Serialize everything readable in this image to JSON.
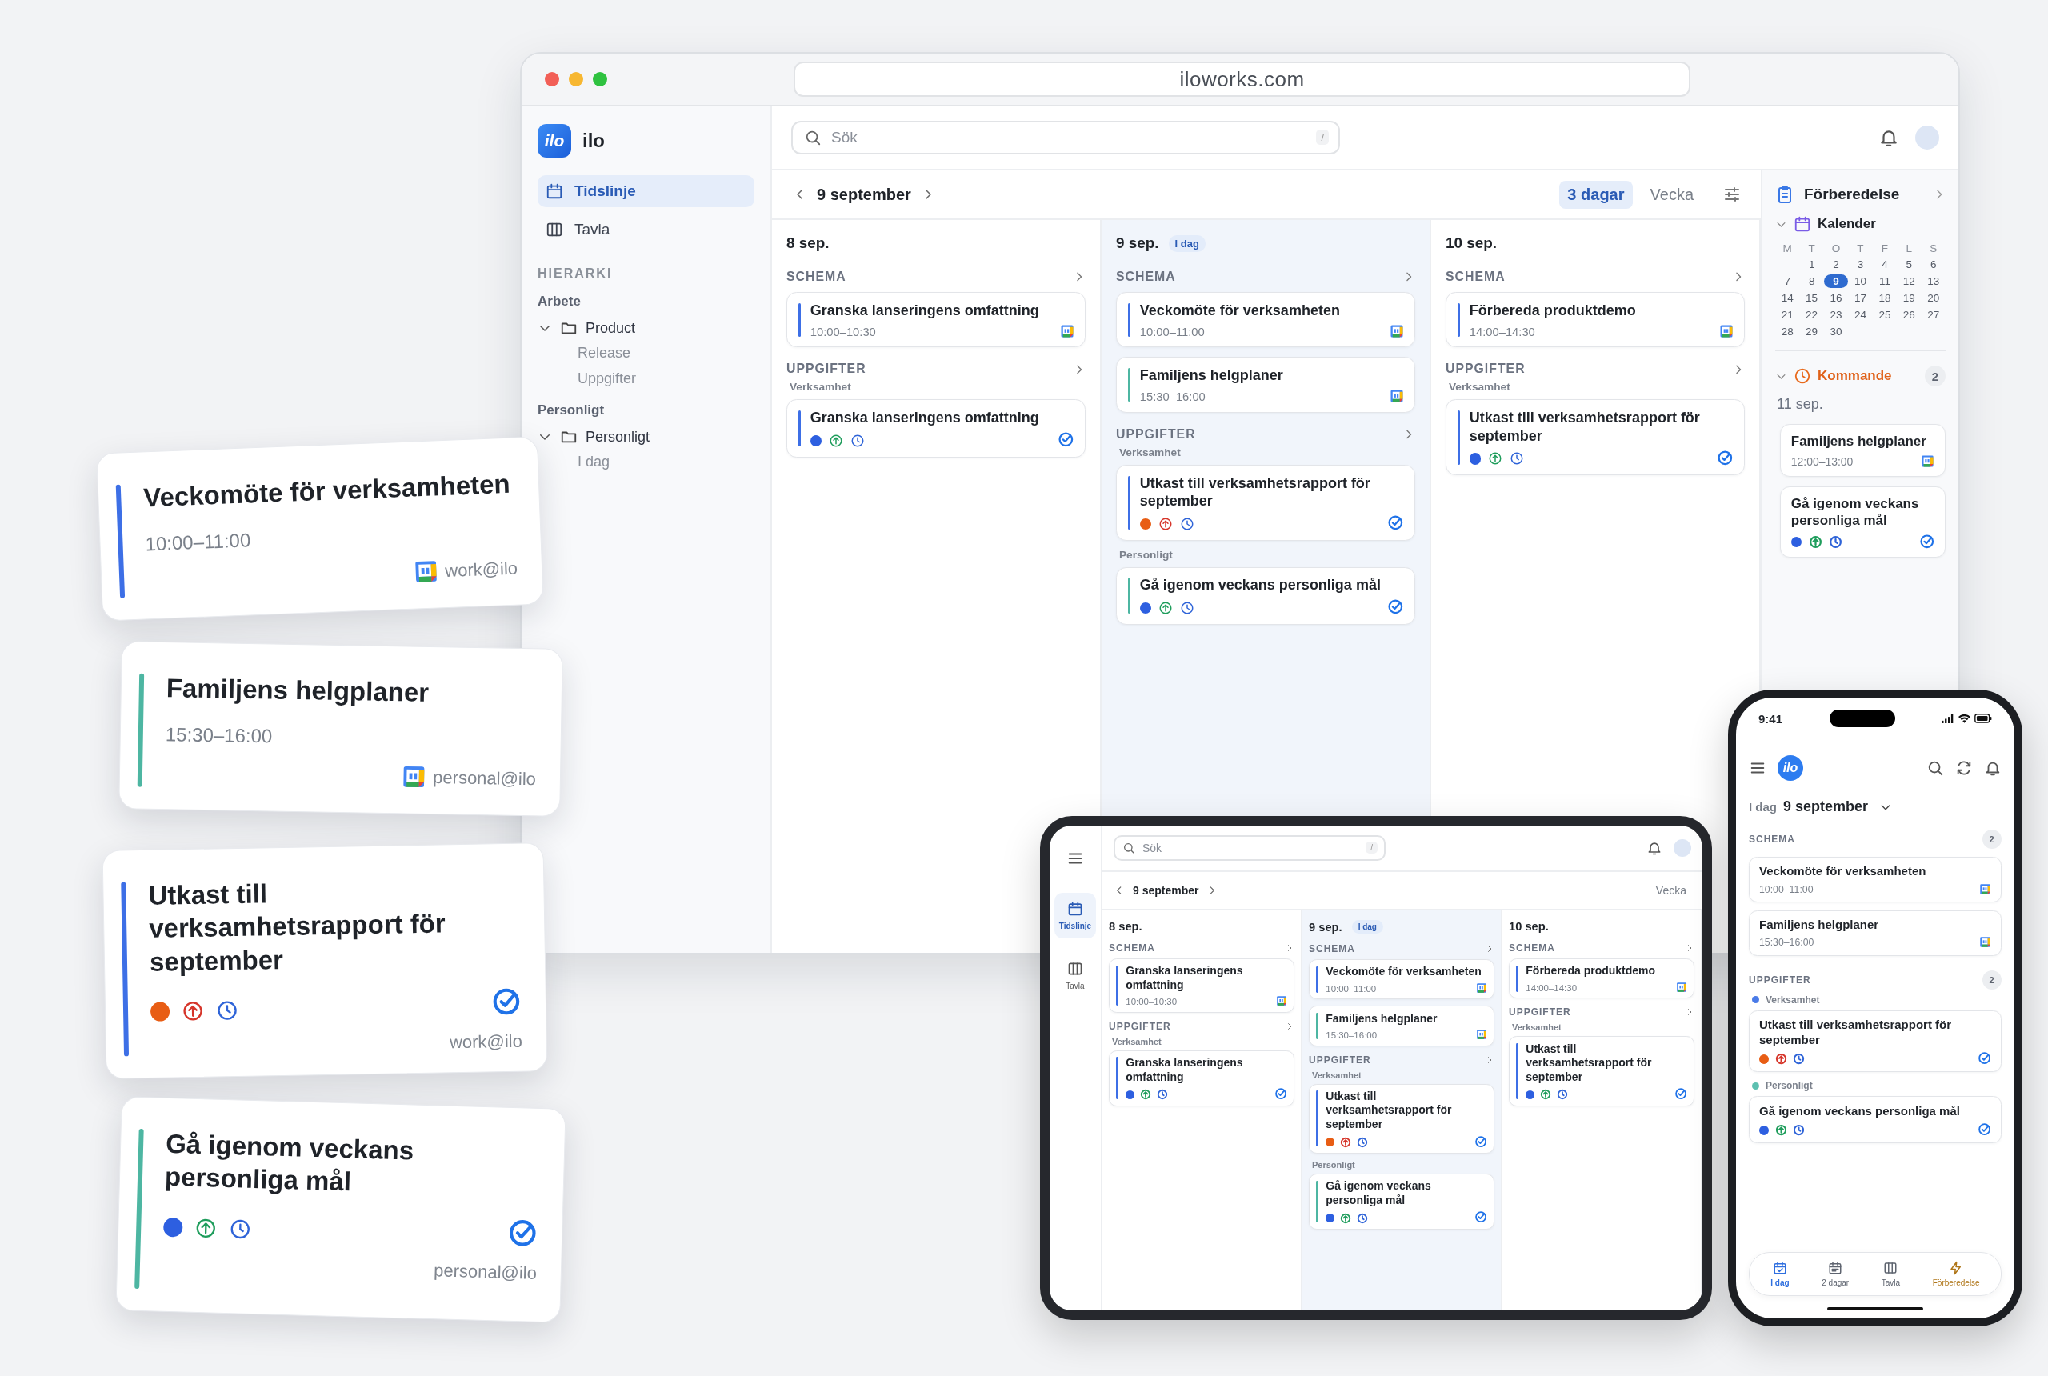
{
  "browser": {
    "url": "iloworks.com",
    "app": {
      "logo_mark": "ilo",
      "name": "ilo"
    },
    "nav": [
      {
        "label": "Tidslinje",
        "kind": "calendar",
        "selected": true
      },
      {
        "label": "Tavla",
        "kind": "board",
        "selected": false
      }
    ],
    "hierarchy_title": "HIERARKI",
    "groups": [
      {
        "label": "Arbete",
        "items": [
          {
            "label": "Product",
            "expanded": true,
            "children": [
              {
                "label": "Release"
              },
              {
                "label": "Uppgifter"
              }
            ]
          }
        ]
      },
      {
        "label": "Personligt",
        "items": [
          {
            "label": "Personligt",
            "expanded": true,
            "children": [
              {
                "label": "I dag"
              }
            ]
          }
        ]
      }
    ],
    "search": {
      "placeholder": "Sök",
      "shortcut": "/"
    },
    "date": "9 september",
    "views": [
      {
        "label": "3 dagar",
        "selected": true
      },
      {
        "label": "Vecka",
        "selected": false
      }
    ],
    "days": [
      {
        "date": "8 sep.",
        "today": false,
        "schedule_label": "SCHEMA",
        "events": [
          {
            "kind": "event",
            "title": "Granska lanseringens omfattning",
            "time": "10:00–10:30",
            "bar": {
              "color": "#3d6fe6"
            }
          }
        ],
        "tasks_label": "UPPGIFTER",
        "task_groups": [
          {
            "label": "Verksamhet",
            "items": [
              {
                "kind": "task",
                "title": "Granska lanseringens omfattning",
                "bar": {
                  "color": "#3d6fe6"
                },
                "color": "#2d5fe0",
                "priority": {
                  "color": "#1f9d5c"
                }
              }
            ]
          }
        ]
      },
      {
        "date": "9 sep.",
        "today": true,
        "badge": "I dag",
        "schedule_label": "SCHEMA",
        "events": [
          {
            "kind": "event",
            "title": "Veckomöte för verksamheten",
            "time": "10:00–11:00",
            "bar": {
              "color": "#3d6fe6"
            }
          },
          {
            "kind": "event",
            "title": "Familjens helgplaner",
            "time": "15:30–16:00",
            "bar": {
              "color": "#4db6a2"
            }
          }
        ],
        "tasks_label": "UPPGIFTER",
        "task_groups": [
          {
            "label": "Verksamhet",
            "items": [
              {
                "kind": "task",
                "title": "Utkast till verksamhetsrapport för september",
                "bar": {
                  "color": "#3d6fe6"
                },
                "color": "#e85d14",
                "priority": {
                  "color": "#d6362b"
                }
              }
            ]
          },
          {
            "label": "Personligt",
            "items": [
              {
                "kind": "task",
                "title": "Gå igenom veckans personliga mål",
                "bar": {
                  "color": "#4db6a2"
                },
                "color": "#2d5fe0",
                "priority": {
                  "color": "#1f9d5c"
                }
              }
            ]
          }
        ]
      },
      {
        "date": "10 sep.",
        "today": false,
        "schedule_label": "SCHEMA",
        "events": [
          {
            "kind": "event",
            "title": "Förbereda produktdemo",
            "time": "14:00–14:30",
            "bar": {
              "color": "#3d6fe6"
            }
          }
        ],
        "tasks_label": "UPPGIFTER",
        "task_groups": [
          {
            "label": "Verksamhet",
            "items": [
              {
                "kind": "task",
                "title": "Utkast till verksamhetsrapport för september",
                "bar": {
                  "color": "#3d6fe6"
                },
                "color": "#2d5fe0",
                "priority": {
                  "color": "#1f9d5c"
                }
              }
            ]
          }
        ]
      }
    ],
    "prep": {
      "title": "Förberedelse",
      "calendar": {
        "label": "Kalender",
        "expanded": true,
        "weekdays": [
          "M",
          "T",
          "O",
          "T",
          "F",
          "L",
          "S"
        ],
        "days": [
          {
            "label": "1",
            "selected": false
          },
          {
            "label": "2",
            "selected": false
          },
          {
            "label": "3",
            "selected": false
          },
          {
            "label": "4",
            "selected": false
          },
          {
            "label": "5",
            "selected": false
          },
          {
            "label": "6",
            "selected": false
          },
          {
            "label": "7",
            "selected": false
          },
          {
            "label": "8",
            "selected": false
          },
          {
            "label": "9",
            "selected": true
          },
          {
            "label": "10",
            "selected": false
          },
          {
            "label": "11",
            "selected": false
          },
          {
            "label": "12",
            "selected": false
          },
          {
            "label": "13",
            "selected": false
          },
          {
            "label": "14",
            "selected": false
          },
          {
            "label": "15",
            "selected": false
          },
          {
            "label": "16",
            "selected": false
          },
          {
            "label": "17",
            "selected": false
          },
          {
            "label": "18",
            "selected": false
          },
          {
            "label": "19",
            "selected": false
          },
          {
            "label": "20",
            "selected": false
          },
          {
            "label": "21",
            "selected": false
          },
          {
            "label": "22",
            "selected": false
          },
          {
            "label": "23",
            "selected": false
          },
          {
            "label": "24",
            "selected": false
          },
          {
            "label": "25",
            "selected": false
          },
          {
            "label": "26",
            "selected": false
          },
          {
            "label": "27",
            "selected": false
          },
          {
            "label": "28",
            "selected": false
          },
          {
            "label": "29",
            "selected": false
          },
          {
            "label": "30",
            "selected": false
          }
        ]
      },
      "upcoming": {
        "label": "Kommande",
        "count": "2",
        "expanded": true,
        "date": "11 sep.",
        "items": [
          {
            "kind": "event",
            "title": "Familjens helgplaner",
            "time": "12:00–13:00"
          },
          {
            "kind": "task",
            "title": "Gå igenom veckans personliga mål",
            "color": "#2d5fe0",
            "priority": {
              "color": "#1f9d5c"
            }
          }
        ]
      }
    }
  },
  "floating_cards": [
    {
      "kind": "event",
      "title": "Veckomöte för verksamheten",
      "time": "10:00–11:00",
      "bar": {
        "color": "#3d6fe6"
      },
      "account": "work@ilo"
    },
    {
      "kind": "event",
      "title": "Familjens helgplaner",
      "time": "15:30–16:00",
      "bar": {
        "color": "#4db6a2"
      },
      "account": "personal@ilo"
    },
    {
      "kind": "task",
      "title": "Utkast till verksamhetsrapport för september",
      "bar": {
        "color": "#3d6fe6"
      },
      "color": "#e85d14",
      "priority": {
        "color": "#d6362b"
      },
      "account": "work@ilo"
    },
    {
      "kind": "task",
      "title": "Gå igenom veckans personliga mål",
      "bar": {
        "color": "#4db6a2"
      },
      "color": "#2d5fe0",
      "priority": {
        "color": "#1f9d5c"
      },
      "account": "personal@ilo"
    }
  ],
  "tablet": {
    "nav": [
      {
        "label": "Tidslinje",
        "kind": "calendar",
        "selected": true
      },
      {
        "label": "Tavla",
        "kind": "board",
        "selected": false
      }
    ],
    "search": {
      "placeholder": "Sök",
      "shortcut": "/"
    },
    "date": "9 september",
    "view": "Vecka",
    "days": [
      {
        "date": "8 sep.",
        "today": false,
        "schedule_label": "SCHEMA",
        "events": [
          {
            "kind": "event",
            "title": "Granska lanseringens omfattning",
            "time": "10:00–10:30",
            "bar": {
              "color": "#3d6fe6"
            }
          }
        ],
        "tasks_label": "UPPGIFTER",
        "task_groups": [
          {
            "label": "Verksamhet",
            "items": [
              {
                "kind": "task",
                "title": "Granska lanseringens omfattning",
                "bar": {
                  "color": "#3d6fe6"
                },
                "color": "#2d5fe0",
                "priority": {
                  "color": "#1f9d5c"
                }
              }
            ]
          }
        ]
      },
      {
        "date": "9 sep.",
        "today": true,
        "badge": "I dag",
        "schedule_label": "SCHEMA",
        "events": [
          {
            "kind": "event",
            "title": "Veckomöte för verksamheten",
            "time": "10:00–11:00",
            "bar": {
              "color": "#3d6fe6"
            }
          },
          {
            "kind": "event",
            "title": "Familjens helgplaner",
            "time": "15:30–16:00",
            "bar": {
              "color": "#4db6a2"
            }
          }
        ],
        "tasks_label": "UPPGIFTER",
        "task_groups": [
          {
            "label": "Verksamhet",
            "items": [
              {
                "kind": "task",
                "title": "Utkast till verksamhetsrapport för september",
                "bar": {
                  "color": "#3d6fe6"
                },
                "color": "#e85d14",
                "priority": {
                  "color": "#d6362b"
                }
              }
            ]
          },
          {
            "label": "Personligt",
            "items": [
              {
                "kind": "task",
                "title": "Gå igenom veckans personliga mål",
                "bar": {
                  "color": "#4db6a2"
                },
                "color": "#2d5fe0",
                "priority": {
                  "color": "#1f9d5c"
                }
              }
            ]
          }
        ]
      },
      {
        "date": "10 sep.",
        "today": false,
        "schedule_label": "SCHEMA",
        "events": [
          {
            "kind": "event",
            "title": "Förbereda produktdemo",
            "time": "14:00–14:30",
            "bar": {
              "color": "#3d6fe6"
            }
          }
        ],
        "tasks_label": "UPPGIFTER",
        "task_groups": [
          {
            "label": "Verksamhet",
            "items": [
              {
                "kind": "task",
                "title": "Utkast till verksamhetsrapport för september",
                "bar": {
                  "color": "#3d6fe6"
                },
                "color": "#2d5fe0",
                "priority": {
                  "color": "#1f9d5c"
                }
              }
            ]
          }
        ]
      }
    ]
  },
  "phone": {
    "time": "9:41",
    "logo_mark": "ilo",
    "today_label": "I dag",
    "date": "9 september",
    "schedule": {
      "label": "SCHEMA",
      "count": "2",
      "items": [
        {
          "kind": "event",
          "title": "Veckomöte för verksamheten",
          "time": "10:00–11:00"
        },
        {
          "kind": "event",
          "title": "Familjens helgplaner",
          "time": "15:30–16:00"
        }
      ]
    },
    "tasks": {
      "label": "UPPGIFTER",
      "count": "2",
      "groups": [
        {
          "label": "Verksamhet",
          "color": "#4a7be8",
          "items": [
            {
              "kind": "task",
              "title": "Utkast till verksamhetsrapport för september",
              "color": "#e85d14",
              "priority": {
                "color": "#d6362b"
              }
            }
          ]
        },
        {
          "label": "Personligt",
          "color": "#5cc0b0",
          "items": [
            {
              "kind": "task",
              "title": "Gå igenom veckans personliga mål",
              "color": "#2d5fe0",
              "priority": {
                "color": "#1f9d5c"
              }
            }
          ]
        }
      ]
    },
    "tabs": [
      {
        "label": "I dag",
        "kind": "today",
        "selected": true,
        "color": "#2f6fdf"
      },
      {
        "label": "2 dagar",
        "kind": "days",
        "selected": false,
        "color": "#5f6570"
      },
      {
        "label": "Tavla",
        "kind": "board",
        "selected": false,
        "color": "#5f6570"
      },
      {
        "label": "Förberedelse",
        "kind": "prep",
        "selected": false,
        "color": "#b0771a"
      }
    ]
  }
}
